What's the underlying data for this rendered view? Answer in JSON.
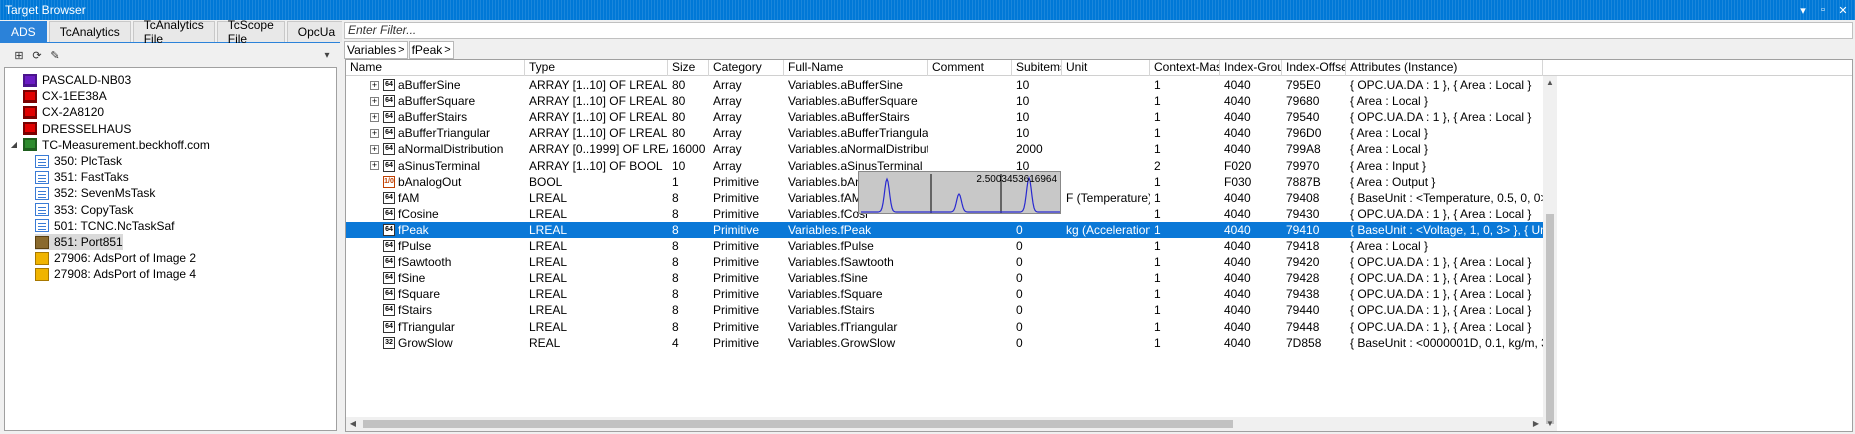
{
  "window": {
    "title": "Target Browser"
  },
  "left": {
    "tabs": [
      {
        "label": "ADS",
        "active": true
      },
      {
        "label": "TcAnalytics",
        "active": false
      },
      {
        "label": "TcAnalytics File",
        "active": false
      },
      {
        "label": "TcScope File",
        "active": false
      },
      {
        "label": "OpcUa",
        "active": false
      }
    ],
    "tree": [
      {
        "label": "PASCALD-NB03",
        "icon": "monitor-purple-icon",
        "level": 0
      },
      {
        "label": "CX-1EE38A",
        "icon": "monitor-red-icon",
        "level": 0
      },
      {
        "label": "CX-2A8120",
        "icon": "monitor-red-icon",
        "level": 0
      },
      {
        "label": "DRESSELHAUS",
        "icon": "monitor-red-icon",
        "level": 0
      },
      {
        "label": "TC-Measurement.beckhoff.com",
        "icon": "monitor-green-icon",
        "level": 0,
        "expanded": true
      },
      {
        "label": "350: PlcTask",
        "icon": "task-icon",
        "level": 1
      },
      {
        "label": "351: FastTaks",
        "icon": "task-icon",
        "level": 1
      },
      {
        "label": "352: SevenMsTask",
        "icon": "task-icon",
        "level": 1
      },
      {
        "label": "353: CopyTask",
        "icon": "task-icon",
        "level": 1
      },
      {
        "label": "501: TCNC.NcTaskSaf",
        "icon": "task-icon",
        "level": 1
      },
      {
        "label": "851: Port851",
        "icon": "port-dark-icon",
        "level": 1,
        "selected": true
      },
      {
        "label": "27906: AdsPort of Image 2",
        "icon": "port-icon",
        "level": 1
      },
      {
        "label": "27908: AdsPort of Image 4",
        "icon": "port-icon",
        "level": 1
      }
    ]
  },
  "right": {
    "filter_placeholder": "Enter Filter...",
    "breadcrumbs": [
      "Variables",
      "fPeak"
    ],
    "columns": [
      "Name",
      "Type",
      "Size",
      "Category",
      "Full-Name",
      "Comment",
      "Subitems",
      "Unit",
      "Context-Mask",
      "Index-Group",
      "Index-Offset",
      "Attributes (Instance)"
    ],
    "rows": [
      {
        "name": "aBufferSine",
        "expandable": true,
        "icon": "lreal",
        "type": "ARRAY [1..10] OF LREAL",
        "size": "80",
        "category": "Array",
        "fullname": "Variables.aBufferSine",
        "comment": "",
        "subitems": "10",
        "unit": "",
        "ctx": "1",
        "ig": "4040",
        "io": "795E0",
        "attr": "{ OPC.UA.DA : 1 }, { Area : Local }"
      },
      {
        "name": "aBufferSquare",
        "expandable": true,
        "icon": "lreal",
        "type": "ARRAY [1..10] OF LREAL",
        "size": "80",
        "category": "Array",
        "fullname": "Variables.aBufferSquare",
        "comment": "",
        "subitems": "10",
        "unit": "",
        "ctx": "1",
        "ig": "4040",
        "io": "79680",
        "attr": "{ Area : Local }"
      },
      {
        "name": "aBufferStairs",
        "expandable": true,
        "icon": "lreal",
        "type": "ARRAY [1..10] OF LREAL",
        "size": "80",
        "category": "Array",
        "fullname": "Variables.aBufferStairs",
        "comment": "",
        "subitems": "10",
        "unit": "",
        "ctx": "1",
        "ig": "4040",
        "io": "79540",
        "attr": "{ OPC.UA.DA : 1 }, { Area : Local }"
      },
      {
        "name": "aBufferTriangular",
        "expandable": true,
        "icon": "lreal",
        "type": "ARRAY [1..10] OF LREAL",
        "size": "80",
        "category": "Array",
        "fullname": "Variables.aBufferTriangular",
        "comment": "",
        "subitems": "10",
        "unit": "",
        "ctx": "1",
        "ig": "4040",
        "io": "796D0",
        "attr": "{ Area : Local }"
      },
      {
        "name": "aNormalDistribution",
        "expandable": true,
        "icon": "lreal",
        "type": "ARRAY [0..1999] OF LREAL",
        "size": "16000",
        "category": "Array",
        "fullname": "Variables.aNormalDistribution",
        "comment": "",
        "subitems": "2000",
        "unit": "",
        "ctx": "1",
        "ig": "4040",
        "io": "799A8",
        "attr": "{ Area : Local }"
      },
      {
        "name": "aSinusTerminal",
        "expandable": true,
        "icon": "lreal",
        "type": "ARRAY [1..10] OF BOOL",
        "size": "10",
        "category": "Array",
        "fullname": "Variables.aSinusTerminal",
        "comment": "",
        "subitems": "10",
        "unit": "",
        "ctx": "2",
        "ig": "F020",
        "io": "79970",
        "attr": "{ Area : Input }"
      },
      {
        "name": "bAnalogOut",
        "expandable": false,
        "icon": "bool",
        "type": "BOOL",
        "size": "1",
        "category": "Primitive",
        "fullname": "Variables.bAna",
        "comment": "",
        "subitems": "",
        "unit": "",
        "ctx": "1",
        "ig": "F030",
        "io": "7887B",
        "attr": "{ Area : Output }"
      },
      {
        "name": "fAM",
        "expandable": false,
        "icon": "lreal",
        "type": "LREAL",
        "size": "8",
        "category": "Primitive",
        "fullname": "Variables.fAM",
        "comment": "",
        "subitems": "",
        "unit": "F (Temperature)",
        "ctx": "1",
        "ig": "4040",
        "io": "79408",
        "attr": "{ BaseUnit : <Temperature, 0.5, 0, 0> }, { User"
      },
      {
        "name": "fCosine",
        "expandable": false,
        "icon": "lreal",
        "type": "LREAL",
        "size": "8",
        "category": "Primitive",
        "fullname": "Variables.fCosi",
        "comment": "",
        "subitems": "",
        "unit": "",
        "ctx": "1",
        "ig": "4040",
        "io": "79430",
        "attr": "{ OPC.UA.DA : 1 }, { Area : Local }"
      },
      {
        "name": "fPeak",
        "expandable": false,
        "icon": "lreal",
        "type": "LREAL",
        "size": "8",
        "category": "Primitive",
        "fullname": "Variables.fPeak",
        "comment": "",
        "subitems": "0",
        "unit": "kg (Acceleration)",
        "ctx": "1",
        "ig": "4040",
        "io": "79410",
        "attr": "{ BaseUnit : <Voltage, 1, 0, 3> }, { UnitTransfc",
        "selected": true
      },
      {
        "name": "fPulse",
        "expandable": false,
        "icon": "lreal",
        "type": "LREAL",
        "size": "8",
        "category": "Primitive",
        "fullname": "Variables.fPulse",
        "comment": "",
        "subitems": "0",
        "unit": "",
        "ctx": "1",
        "ig": "4040",
        "io": "79418",
        "attr": "{ Area : Local }"
      },
      {
        "name": "fSawtooth",
        "expandable": false,
        "icon": "lreal",
        "type": "LREAL",
        "size": "8",
        "category": "Primitive",
        "fullname": "Variables.fSawtooth",
        "comment": "",
        "subitems": "0",
        "unit": "",
        "ctx": "1",
        "ig": "4040",
        "io": "79420",
        "attr": "{ OPC.UA.DA : 1 }, { Area : Local }"
      },
      {
        "name": "fSine",
        "expandable": false,
        "icon": "lreal",
        "type": "LREAL",
        "size": "8",
        "category": "Primitive",
        "fullname": "Variables.fSine",
        "comment": "",
        "subitems": "0",
        "unit": "",
        "ctx": "1",
        "ig": "4040",
        "io": "79428",
        "attr": "{ OPC.UA.DA : 1 }, { Area : Local }"
      },
      {
        "name": "fSquare",
        "expandable": false,
        "icon": "lreal",
        "type": "LREAL",
        "size": "8",
        "category": "Primitive",
        "fullname": "Variables.fSquare",
        "comment": "",
        "subitems": "0",
        "unit": "",
        "ctx": "1",
        "ig": "4040",
        "io": "79438",
        "attr": "{ OPC.UA.DA : 1 }, { Area : Local }"
      },
      {
        "name": "fStairs",
        "expandable": false,
        "icon": "lreal",
        "type": "LREAL",
        "size": "8",
        "category": "Primitive",
        "fullname": "Variables.fStairs",
        "comment": "",
        "subitems": "0",
        "unit": "",
        "ctx": "1",
        "ig": "4040",
        "io": "79440",
        "attr": "{ OPC.UA.DA : 1 }, { Area : Local }"
      },
      {
        "name": "fTriangular",
        "expandable": false,
        "icon": "lreal",
        "type": "LREAL",
        "size": "8",
        "category": "Primitive",
        "fullname": "Variables.fTriangular",
        "comment": "",
        "subitems": "0",
        "unit": "",
        "ctx": "1",
        "ig": "4040",
        "io": "79448",
        "attr": "{ OPC.UA.DA : 1 }, { Area : Local }"
      },
      {
        "name": "GrowSlow",
        "expandable": false,
        "icon": "real",
        "type": "REAL",
        "size": "4",
        "category": "Primitive",
        "fullname": "Variables.GrowSlow",
        "comment": "",
        "subitems": "0",
        "unit": "",
        "ctx": "1",
        "ig": "4040",
        "io": "7D858",
        "attr": "{ BaseUnit : <0000001D, 0.1, kg/m, 3> }, { Use"
      }
    ],
    "tooltip": {
      "value": "2.5003453616964"
    }
  },
  "colors": {
    "accent": "#0078d7",
    "selection": "#0a78d7",
    "sparkline": "#2a2ad0"
  }
}
